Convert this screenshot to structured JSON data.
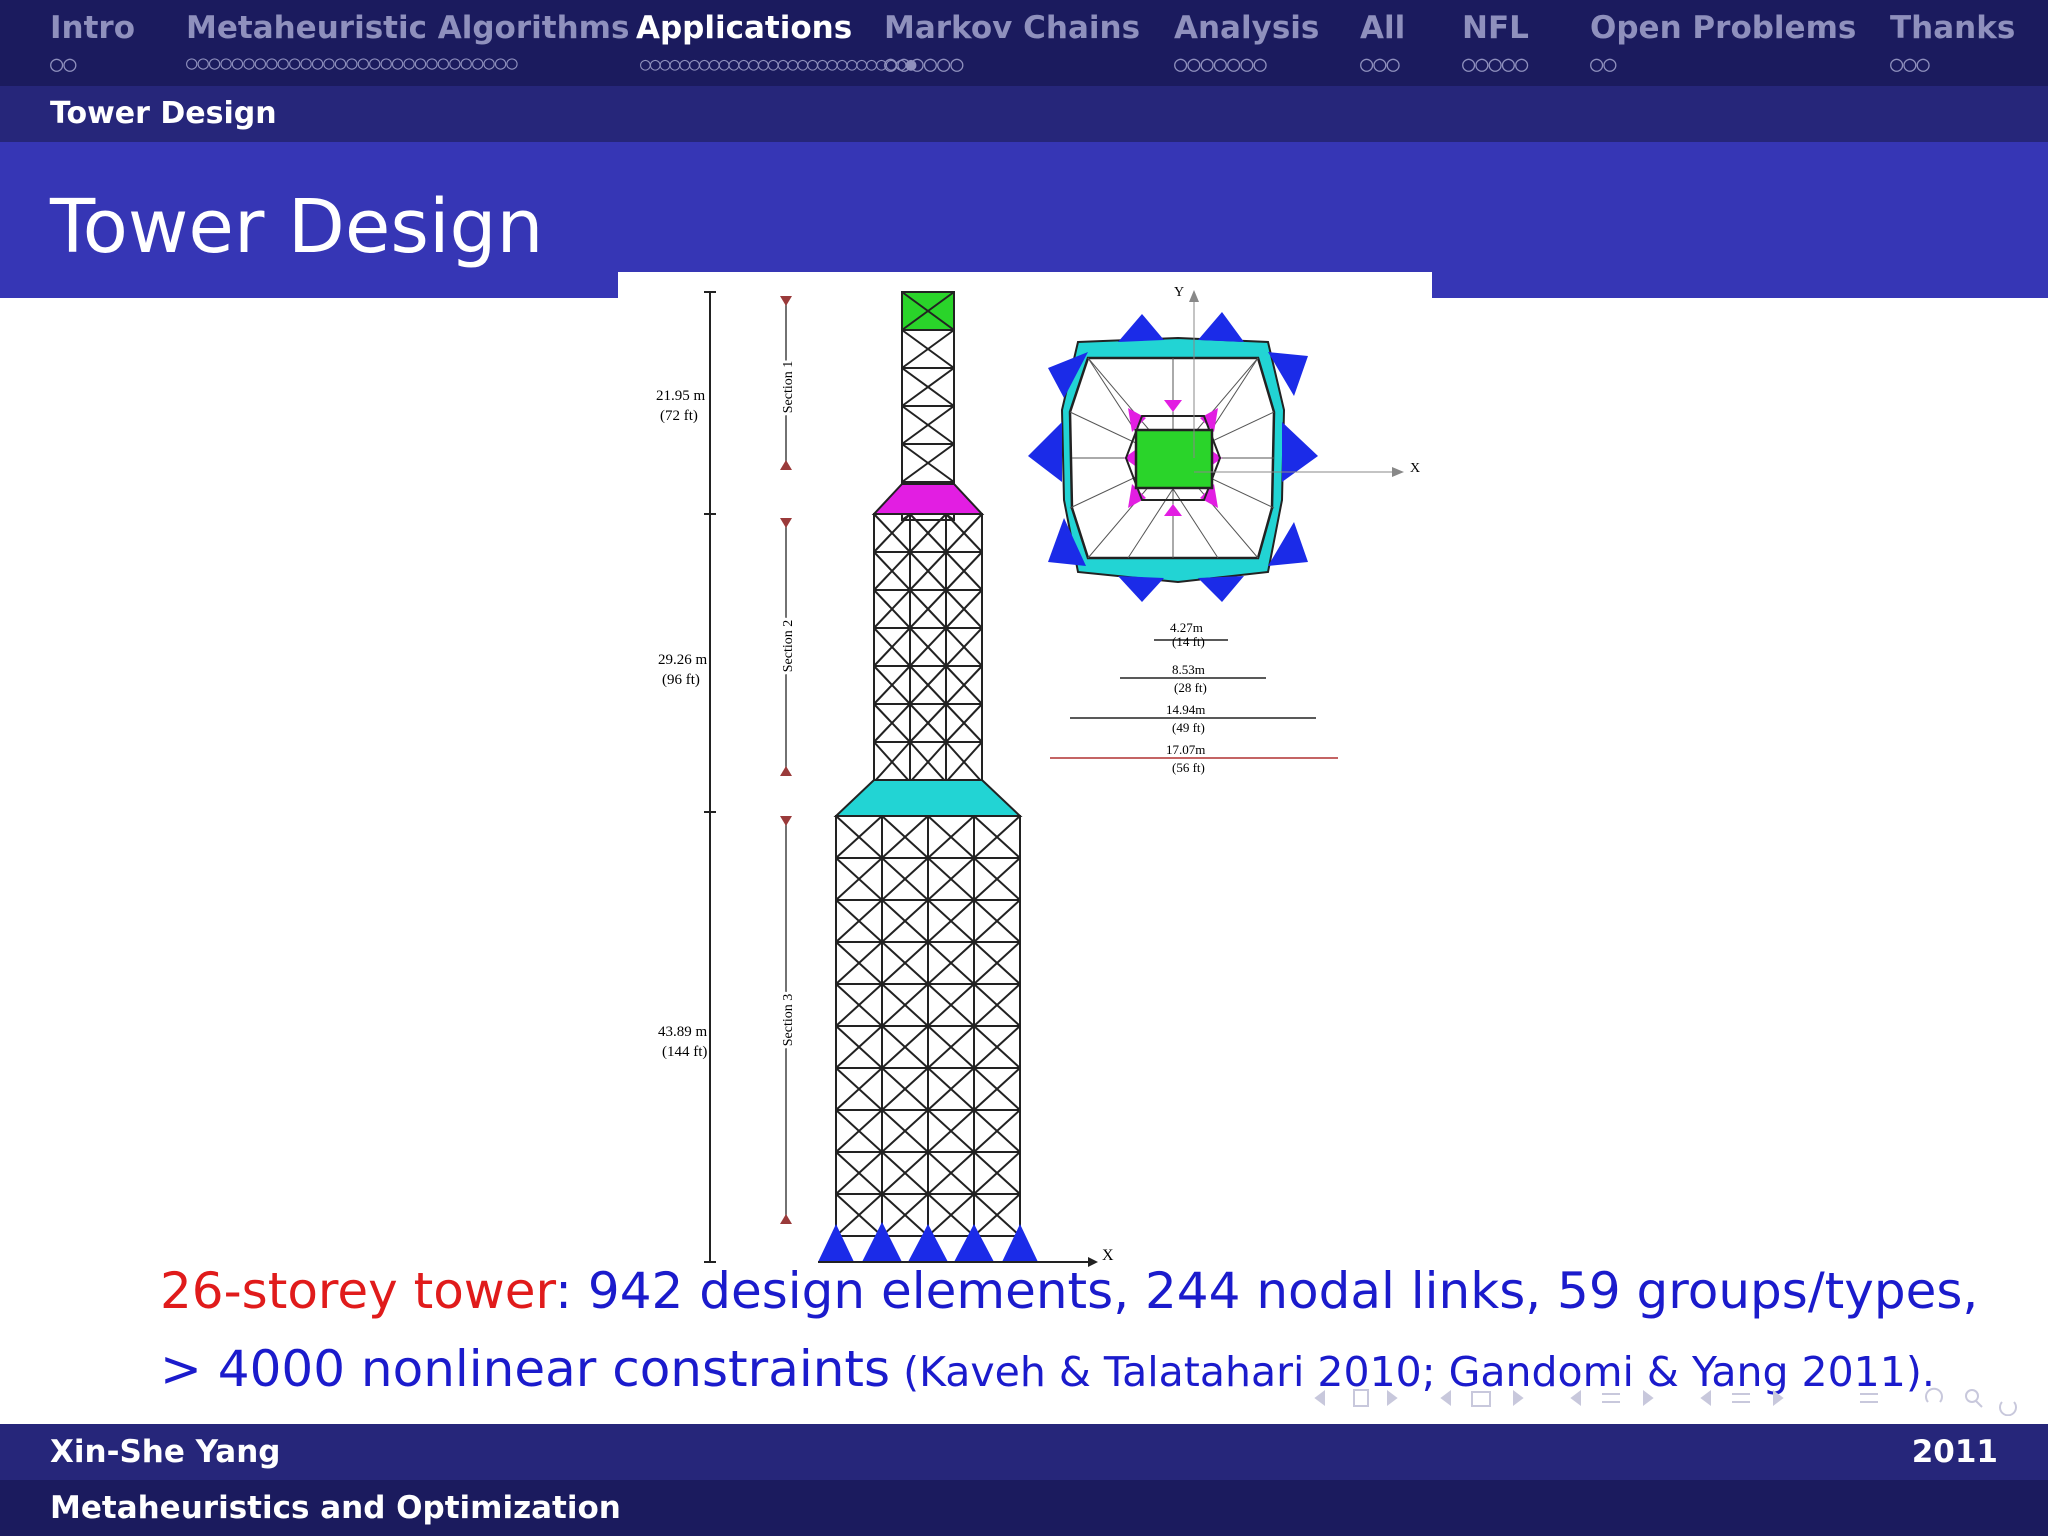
{
  "nav": {
    "sections": [
      {
        "label": "Intro",
        "dots": "○○"
      },
      {
        "label": "Metaheuristic Algorithms",
        "dots": "○○○○○○○○○○○○○○○○○○○○○○○○○○○○○"
      },
      {
        "label": "Applications",
        "dots": "○○○○○○○○○○○○○○○○○○○○○○○○○○○●"
      },
      {
        "label": "Markov Chains",
        "dots": "○○○○○○"
      },
      {
        "label": "Analysis",
        "dots": "○○○○○○○"
      },
      {
        "label": "All",
        "dots": "○○○"
      },
      {
        "label": "NFL",
        "dots": "○○○○○"
      },
      {
        "label": "Open Problems",
        "dots": "○○"
      },
      {
        "label": "Thanks",
        "dots": "○○○"
      }
    ],
    "active_index": 2
  },
  "subsection": "Tower Design",
  "frame_title": "Tower Design",
  "figure": {
    "dims_left": [
      {
        "m": "21.95 m",
        "ft": "(72 ft)"
      },
      {
        "m": "29.26 m",
        "ft": "(96 ft)"
      },
      {
        "m": "43.89 m",
        "ft": "(144 ft)"
      }
    ],
    "sections": [
      "Section 1",
      "Section 2",
      "Section 3"
    ],
    "axis_x": "X",
    "axis_y": "Y",
    "plan_dims": [
      {
        "m": "4.27m",
        "ft": "(14 ft)"
      },
      {
        "m": "8.53m",
        "ft": "(28 ft)"
      },
      {
        "m": "14.94m",
        "ft": "(49 ft)"
      },
      {
        "m": "17.07m",
        "ft": "(56 ft)"
      }
    ]
  },
  "caption": {
    "highlight": "26-storey tower",
    "line1_rest": ":  942 design elements, 244 nodal links, 59 groups/types,",
    "line2_main": "> 4000 nonlinear constraints",
    "line2_cite": " (Kaveh & Talatahari 2010; Gandomi & Yang 2011)."
  },
  "footer": {
    "author": "Xin-She Yang",
    "year": "2011",
    "talk": "Metaheuristics and Optimization"
  },
  "colors": {
    "nav_bg": "#1b1b5e",
    "title_bg": "#3636b5",
    "highlight": "#e01b1b",
    "body_text": "#1b1bcc"
  }
}
